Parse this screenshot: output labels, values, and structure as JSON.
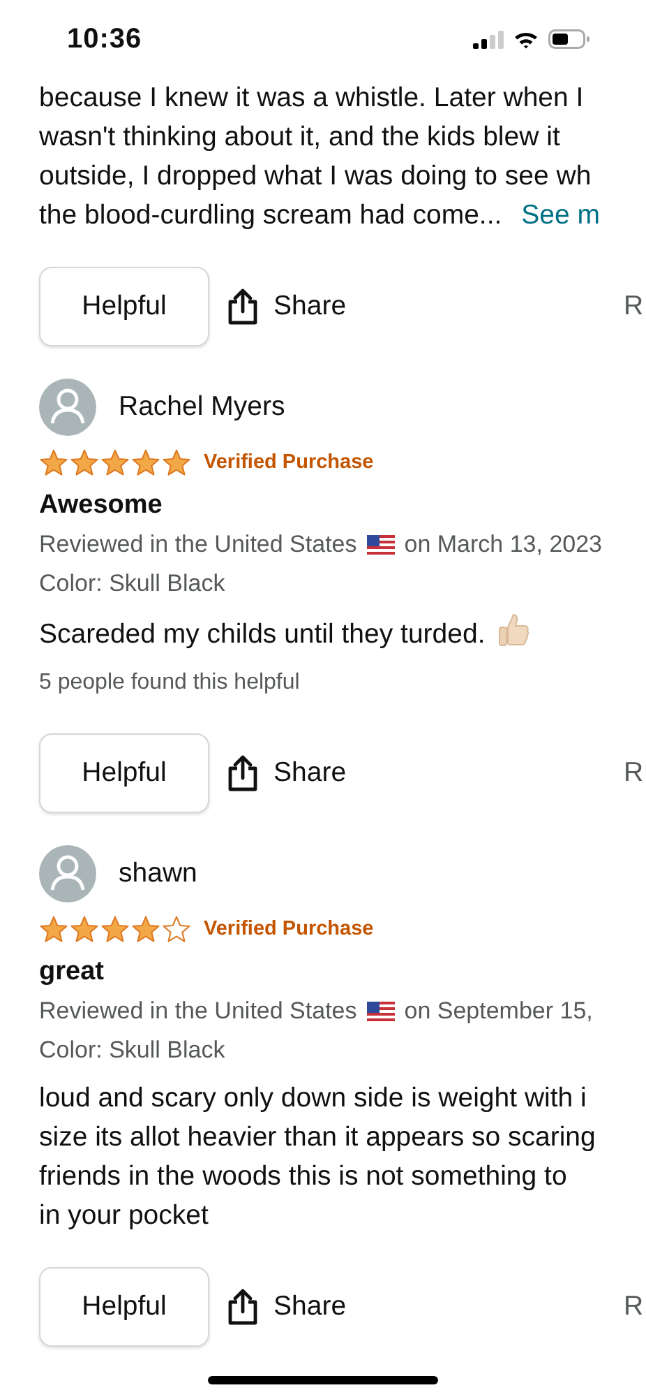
{
  "status_bar": {
    "time": "10:36"
  },
  "reviews": [
    {
      "body_lines": [
        "because I knew it was a whistle. Later when I",
        "wasn't thinking about it, and the kids blew it",
        "outside, I dropped what I was doing to see wh",
        "the blood-curdling scream had come..."
      ],
      "see_more": "See m",
      "actions": {
        "helpful": "Helpful",
        "share": "Share",
        "report": "R"
      }
    },
    {
      "author": "Rachel Myers",
      "stars": 5,
      "verified": "Verified Purchase",
      "title": "Awesome",
      "reviewed_in": "Reviewed in the United States",
      "date": "on March 13, 2023",
      "variant": "Color: Skull Black",
      "body_lines": [
        "Scareded my childs until they turded."
      ],
      "thumbs_up_emoji": true,
      "helpful_count": "5 people found this helpful",
      "actions": {
        "helpful": "Helpful",
        "share": "Share",
        "report": "R"
      }
    },
    {
      "author": "shawn",
      "stars": 4,
      "verified": "Verified Purchase",
      "title": "great",
      "reviewed_in": "Reviewed in the United States",
      "date": "on September 15,",
      "variant": "Color: Skull Black",
      "body_lines": [
        "loud and scary only down side is weight with i",
        "size its allot heavier than it appears so scaring",
        "friends in the woods this is not something to",
        "in your pocket"
      ],
      "actions": {
        "helpful": "Helpful",
        "share": "Share",
        "report": "R"
      }
    }
  ]
}
